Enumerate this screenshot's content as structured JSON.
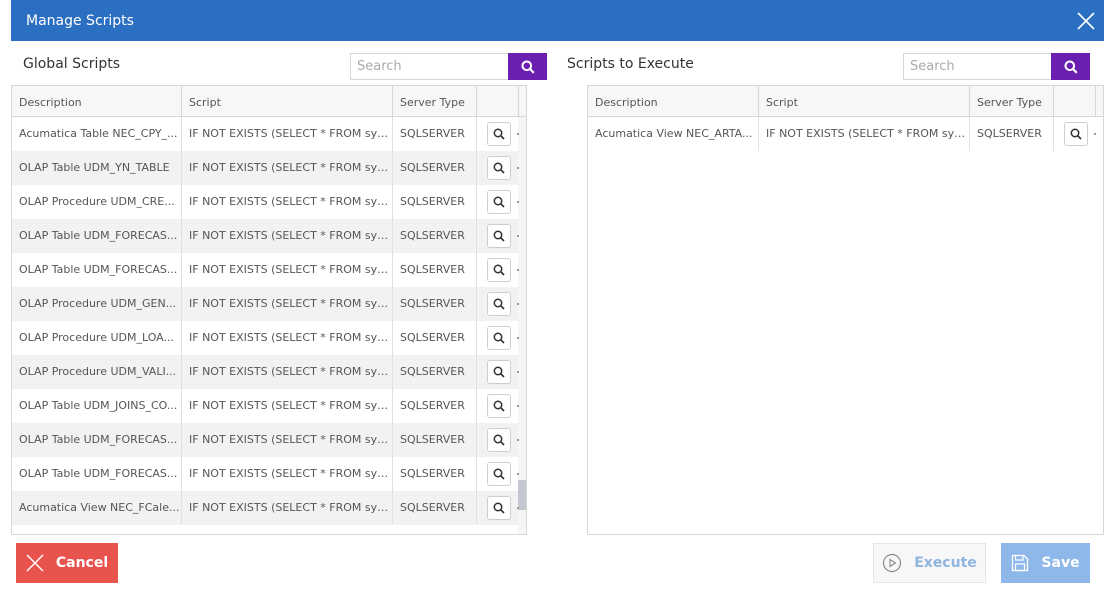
{
  "dialog": {
    "title": "Manage Scripts"
  },
  "global": {
    "title": "Global Scripts",
    "search_placeholder": "Search",
    "columns": [
      "Description",
      "Script",
      "Server Type"
    ],
    "rows": [
      {
        "description": "Acumatica Table NEC_CPY_...",
        "script": "IF NOT EXISTS (SELECT * FROM sys....",
        "server": "SQLSERVER"
      },
      {
        "description": "OLAP Table UDM_YN_TABLE",
        "script": "IF NOT EXISTS (SELECT * FROM sys....",
        "server": "SQLSERVER"
      },
      {
        "description": "OLAP Procedure UDM_CRE...",
        "script": "IF NOT EXISTS (SELECT * FROM sys....",
        "server": "SQLSERVER"
      },
      {
        "description": "OLAP Table UDM_FORECAS...",
        "script": "IF NOT EXISTS (SELECT * FROM sys....",
        "server": "SQLSERVER"
      },
      {
        "description": "OLAP Table UDM_FORECAS...",
        "script": "IF NOT EXISTS (SELECT * FROM sys....",
        "server": "SQLSERVER"
      },
      {
        "description": "OLAP Procedure UDM_GEN...",
        "script": "IF NOT EXISTS (SELECT * FROM sys....",
        "server": "SQLSERVER"
      },
      {
        "description": "OLAP Procedure UDM_LOA...",
        "script": "IF NOT EXISTS (SELECT * FROM sys....",
        "server": "SQLSERVER"
      },
      {
        "description": "OLAP Procedure UDM_VALI...",
        "script": "IF NOT EXISTS (SELECT * FROM sys....",
        "server": "SQLSERVER"
      },
      {
        "description": "OLAP Table UDM_JOINS_CO...",
        "script": "IF NOT EXISTS (SELECT * FROM sys....",
        "server": "SQLSERVER"
      },
      {
        "description": "OLAP Table UDM_FORECAS...",
        "script": "IF NOT EXISTS (SELECT * FROM sys....",
        "server": "SQLSERVER"
      },
      {
        "description": "OLAP Table UDM_FORECAS...",
        "script": "IF NOT EXISTS (SELECT * FROM sys....",
        "server": "SQLSERVER"
      },
      {
        "description": "Acumatica View NEC_FCale...",
        "script": "IF NOT EXISTS (SELECT * FROM sys....",
        "server": "SQLSERVER"
      }
    ]
  },
  "execute": {
    "title": "Scripts to Execute",
    "search_placeholder": "Search",
    "columns": [
      "Description",
      "Script",
      "Server Type"
    ],
    "rows": [
      {
        "description": "Acumatica View NEC_ARTA...",
        "script": "IF NOT EXISTS (SELECT * FROM sys....",
        "server": "SQLSERVER"
      }
    ]
  },
  "buttons": {
    "cancel": "Cancel",
    "execute": "Execute",
    "save": "Save"
  },
  "colors": {
    "titlebar": "#2b6fc2",
    "search_button": "#6a1fb0",
    "cancel": "#e8534d",
    "save": "#8fb8ea"
  },
  "icons": {
    "close": "close-icon",
    "search": "search-icon",
    "view": "search-icon",
    "cancel": "close-icon",
    "execute": "play-circle-icon",
    "save": "save-icon"
  }
}
